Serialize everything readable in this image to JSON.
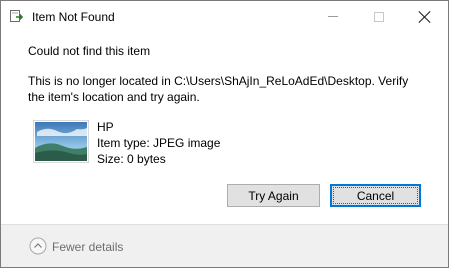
{
  "window": {
    "title": "Item Not Found",
    "icon": "file-move-icon"
  },
  "caption_buttons": {
    "minimize": "minimize-icon",
    "maximize": "maximize-icon",
    "close": "close-icon"
  },
  "content": {
    "heading": "Could not find this item",
    "message": "This is no longer located in C:\\Users\\ShAjIn_ReLoAdEd\\Desktop. Verify the item's location and try again."
  },
  "file": {
    "name": "HP",
    "type": "Item type: JPEG image",
    "size": "Size: 0 bytes",
    "thumbnail": "landscape-image-icon"
  },
  "buttons": {
    "try_again": "Try Again",
    "cancel": "Cancel"
  },
  "footer": {
    "toggle_label": "Fewer details",
    "toggle_icon": "chevron-up-circle-icon"
  },
  "colors": {
    "accent": "#0078d7",
    "footer_bg": "#f0f0f0",
    "button_bg": "#e1e1e1",
    "muted_text": "#6d6d6d"
  }
}
